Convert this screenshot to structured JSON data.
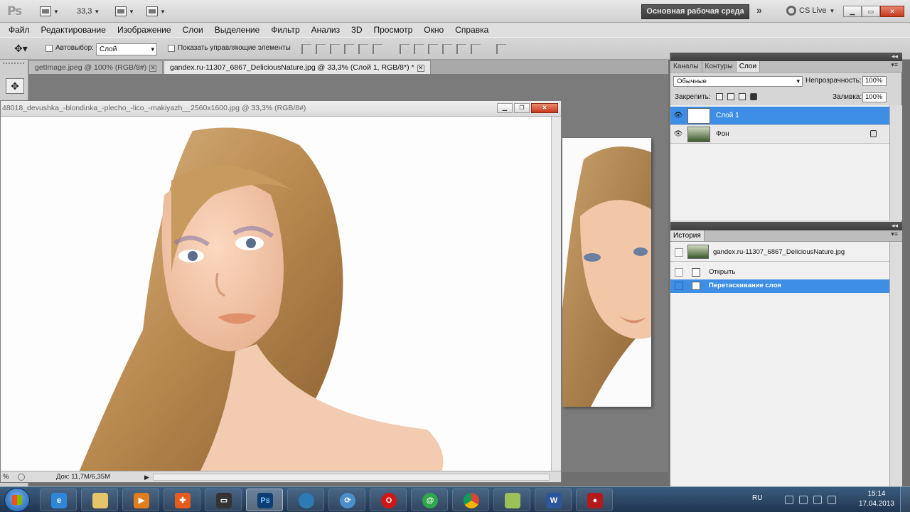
{
  "app": {
    "logo": "Ps",
    "zoom": "33,3",
    "workspace_button": "Основная рабочая среда",
    "cs_live": "CS Live",
    "min": "▁",
    "max": "▭",
    "close": "✕"
  },
  "menu": [
    "Файл",
    "Редактирование",
    "Изображение",
    "Слои",
    "Выделение",
    "Фильтр",
    "Анализ",
    "3D",
    "Просмотр",
    "Окно",
    "Справка"
  ],
  "options": {
    "auto_select_label": "Автовыбор:",
    "auto_select_value": "Слой",
    "show_controls_label": "Показать управляющие элементы"
  },
  "doc_tabs": [
    {
      "label": "getImage.jpeg @ 100% (RGB/8#)",
      "active": false
    },
    {
      "label": "gandex.ru-11307_6867_DeliciousNature.jpg @ 33,3% (Слой 1, RGB/8*) *",
      "active": true
    }
  ],
  "floating_doc": {
    "title": "48018_devushka_-blondinka_-plecho_-lico_-makiyazh__2560x1600.jpg @ 33,3% (RGB/8#)",
    "status_zoom": "%",
    "status_doc": "Док: 11,7M/6,35M"
  },
  "layers_panel": {
    "tabs": [
      "Каналы",
      "Контуры",
      "Слои"
    ],
    "active_tab": "Слои",
    "blend_mode": "Обычные",
    "opacity_label": "Непрозрачность:",
    "opacity_value": "100%",
    "lock_label": "Закрепить:",
    "fill_label": "Заливка:",
    "fill_value": "100%",
    "layers": [
      {
        "name": "Слой 1",
        "selected": true
      },
      {
        "name": "Фон",
        "selected": false,
        "locked": true
      }
    ]
  },
  "history_panel": {
    "tab": "История",
    "snapshot": "gandex.ru-11307_6867_DeliciousNature.jpg",
    "steps": [
      {
        "name": "Открыть",
        "selected": false
      },
      {
        "name": "Перетаскивание слоя",
        "selected": true
      }
    ]
  },
  "taskbar": {
    "lang": "RU",
    "time": "15:14",
    "date": "17.04.2013",
    "apps": [
      "internet-explorer",
      "file-explorer",
      "media-player",
      "app-orange",
      "terminal",
      "photoshop",
      "globe",
      "network",
      "opera",
      "mail-agent",
      "chrome",
      "notes",
      "word",
      "recorder"
    ]
  },
  "colors": {
    "selection_blue": "#3d8ee4",
    "close_red": "#c8391b",
    "panel_header": "#4a4a4a"
  }
}
